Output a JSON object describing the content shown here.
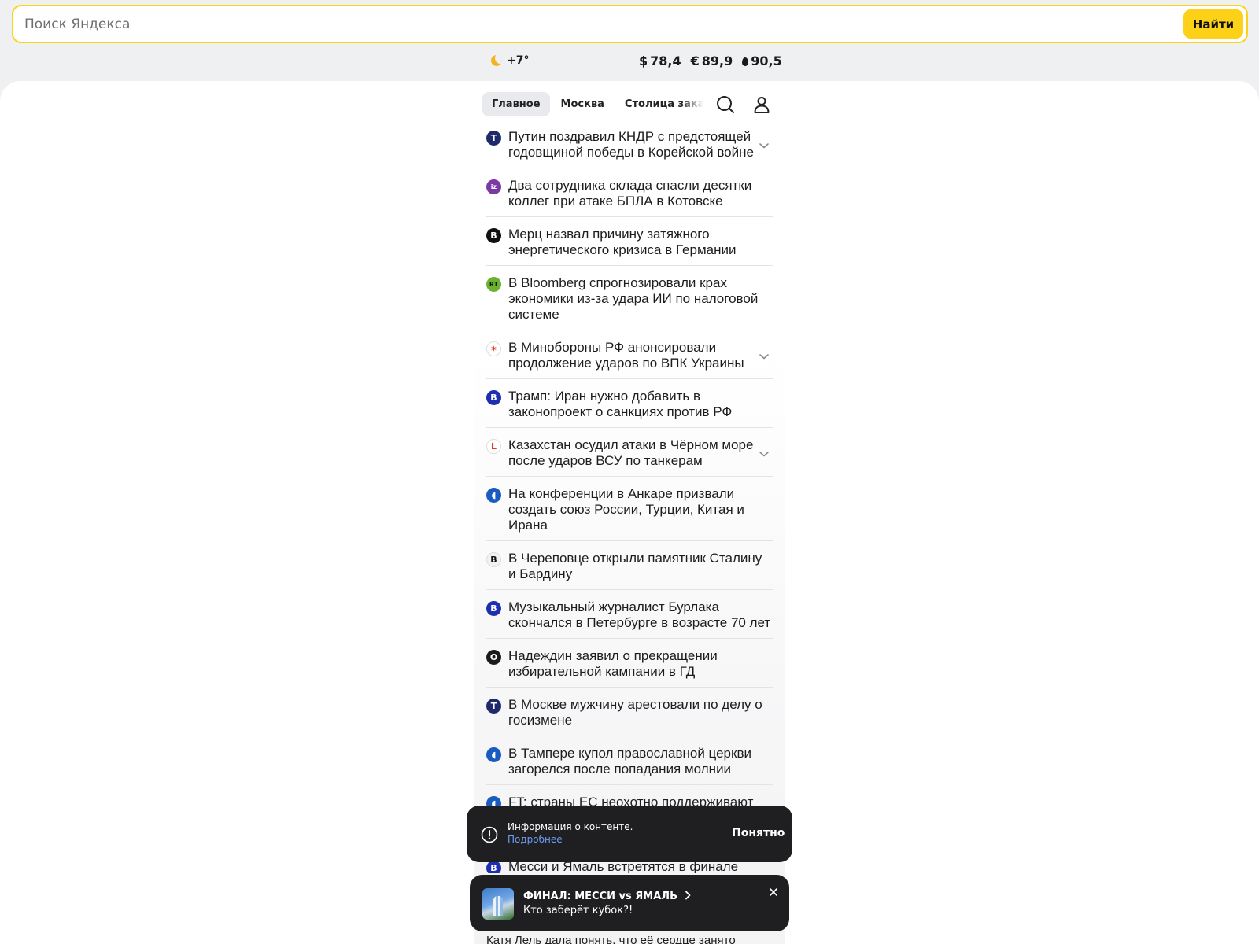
{
  "search": {
    "placeholder": "Поиск Яндекса",
    "value": "",
    "button_label": "Найти"
  },
  "informers": {
    "weather": {
      "icon": "moon-icon",
      "temp": "+7°"
    },
    "rates": [
      {
        "symbol": "$",
        "value": "78,4"
      },
      {
        "symbol": "€",
        "value": "89,9"
      },
      {
        "symbol": "oil-drop-icon",
        "value": "90,5"
      }
    ]
  },
  "tabs": [
    {
      "label": "Главное",
      "active": true
    },
    {
      "label": "Москва",
      "active": false
    },
    {
      "label": "Столица закатов",
      "active": false
    }
  ],
  "news": [
    {
      "source_icon": "t-circle-icon",
      "color": "#1f2a6b",
      "text": "Путин поздравил КНДР с предстоящей годовщиной победы в Корейской войне",
      "expandable": true
    },
    {
      "source_icon": "iz-icon",
      "color": "#7b3aa3",
      "text": "Два сотрудника склада спасли десятки коллег при атаке БПЛА в Котовске",
      "expandable": false
    },
    {
      "source_icon": "vedomosti-icon",
      "color": "#111111",
      "text": "Мерц назвал причину затяжного энергетического кризиса в Германии",
      "expandable": false
    },
    {
      "source_icon": "rt-icon",
      "color": "#6cb230",
      "text": "В Bloomberg спрогнозировали крах экономики из-за удара ИИ по налоговой системе",
      "expandable": false
    },
    {
      "source_icon": "star-icon",
      "color": "#ffffff",
      "text": "В Минобороны РФ анонсировали продолжение ударов по ВПК Украины",
      "expandable": true
    },
    {
      "source_icon": "b-circle-icon",
      "color": "#1d2fb0",
      "text": "Трамп: Иран нужно добавить в законопроект о санкциях против РФ",
      "expandable": false
    },
    {
      "source_icon": "life-icon",
      "color": "#ffffff",
      "text": "Казахстан осудил атаки в Чёрном море после ударов ВСУ по танкерам",
      "expandable": true
    },
    {
      "source_icon": "ria-icon",
      "color": "#1a5bbf",
      "text": "На конференции в Анкаре призвали создать союз России, Турции, Китая и Ирана",
      "expandable": false
    },
    {
      "source_icon": "kommersant-icon",
      "color": "#f2f2f2",
      "text": "В Череповце открыли памятник Сталину и Бардину",
      "expandable": false
    },
    {
      "source_icon": "b-circle-icon",
      "color": "#1d2fb0",
      "text": "Музыкальный журналист Бурлака скончался в Петербурге в возрасте 70 лет",
      "expandable": false
    },
    {
      "source_icon": "o-circle-icon",
      "color": "#1b1b1b",
      "text": "Надеждин заявил о прекращении избирательной кампании в ГД",
      "expandable": false
    },
    {
      "source_icon": "t-circle-icon",
      "color": "#1f2a6b",
      "text": "В Москве мужчину арестовали по делу о госизмене",
      "expandable": false
    },
    {
      "source_icon": "ria-icon",
      "color": "#1a5bbf",
      "text": "В Тампере купол православной церкви загорелся после попадания молнии",
      "expandable": false
    },
    {
      "source_icon": "ria-icon",
      "color": "#1a5bbf",
      "text": "FT: страны ЕС неохотно поддерживают санкции против РФ из-за ущерба их бизнесу",
      "expandable": false
    },
    {
      "source_icon": "b-circle-icon",
      "color": "#1d2fb0",
      "text": "Месси и Ямаль встретятся в финале",
      "expandable": false
    }
  ],
  "content_notice": {
    "title": "Информация о контенте.",
    "link": "Подробнее",
    "button": "Понятно"
  },
  "promo": {
    "title": "ФИНАЛ: МЕССИ vs ЯМАЛЬ",
    "subtitle": "Кто заберёт кубок?!"
  },
  "bottom_peek": "Катя Лель дала понять, что её сердце занято"
}
